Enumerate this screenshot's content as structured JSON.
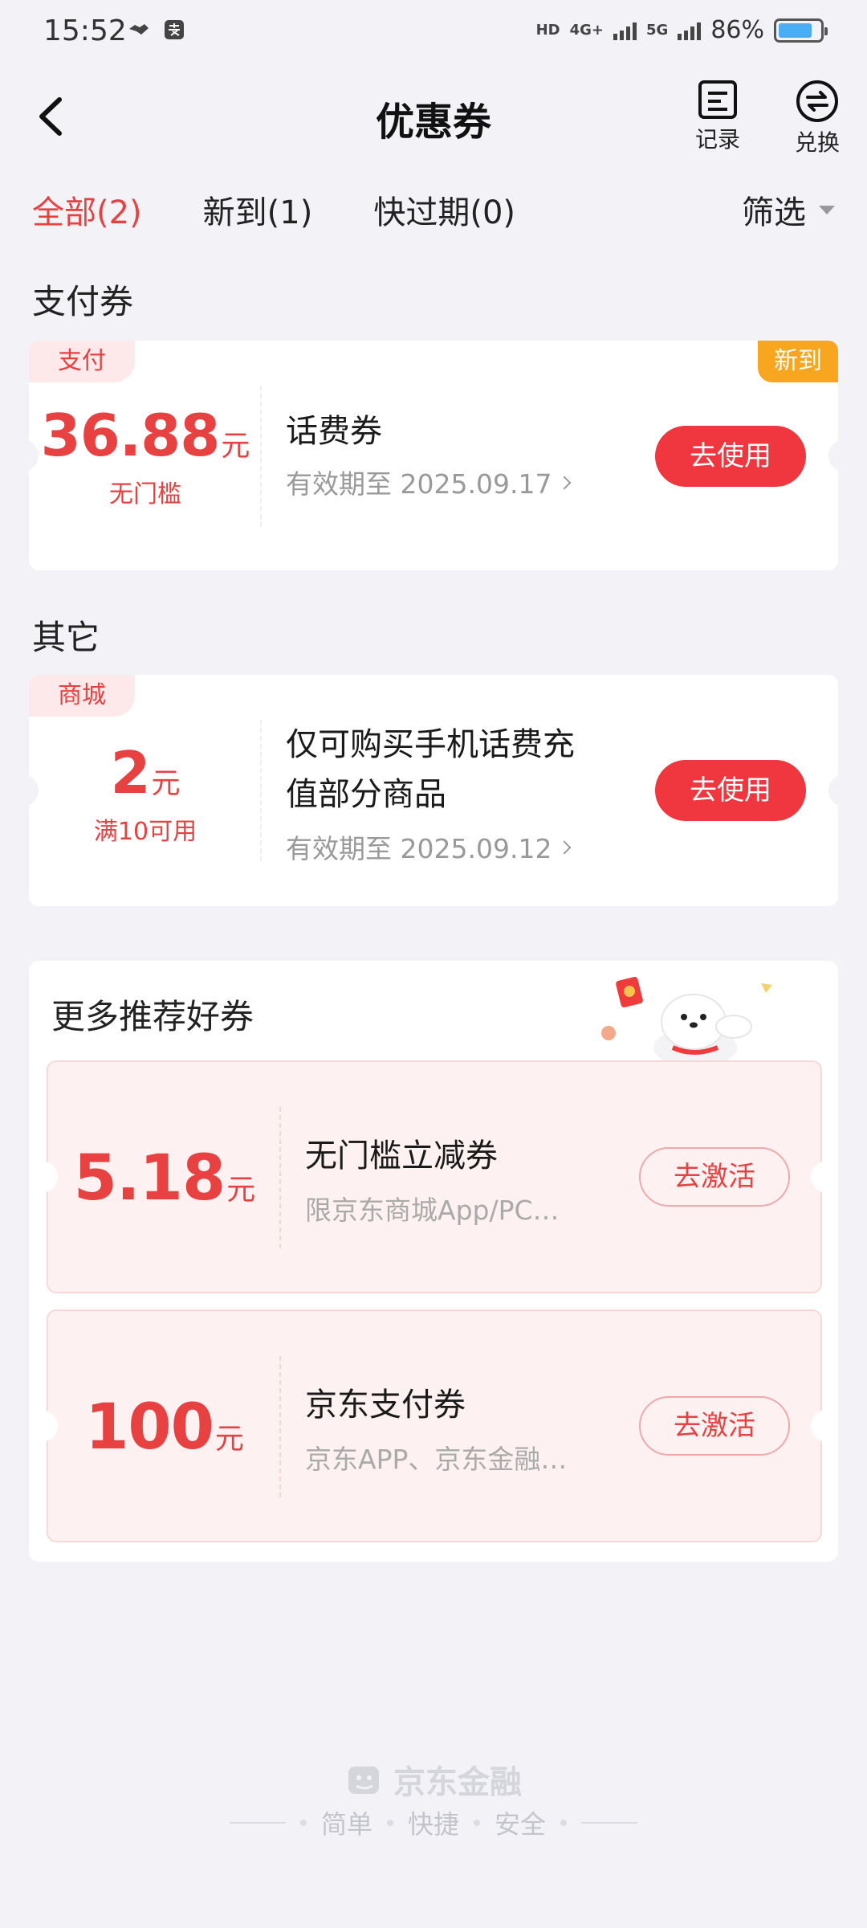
{
  "status": {
    "time": "15:52",
    "battery": "86%",
    "network1": "HD",
    "network2": "4G+",
    "network3": "5G"
  },
  "nav": {
    "title": "优惠券",
    "record_label": "记录",
    "exchange_label": "兑换"
  },
  "tabs": [
    {
      "label": "全部(2)",
      "active": true
    },
    {
      "label": "新到(1)",
      "active": false
    },
    {
      "label": "快过期(0)",
      "active": false
    }
  ],
  "filter_label": "筛选",
  "sections": {
    "pay": {
      "title": "支付券",
      "coupon": {
        "tag": "支付",
        "badge": "新到",
        "amount": "36.88",
        "unit": "元",
        "condition": "无门槛",
        "title": "话费券",
        "date": "有效期至 2025.09.17",
        "button": "去使用"
      }
    },
    "other": {
      "title": "其它",
      "coupon": {
        "tag": "商城",
        "amount": "2",
        "unit": "元",
        "condition": "满10可用",
        "title_line1": "仅可购买手机话费充",
        "title_line2": "值部分商品",
        "date": "有效期至 2025.09.12",
        "button": "去使用"
      }
    }
  },
  "recommend": {
    "title": "更多推荐好券",
    "items": [
      {
        "amount": "5.18",
        "unit": "元",
        "title": "无门槛立减券",
        "desc": "限京东商城App/PC…",
        "button": "去激活"
      },
      {
        "amount": "100",
        "unit": "元",
        "title": "京东支付券",
        "desc": "京东APP、京东金融…",
        "button": "去激活"
      }
    ]
  },
  "footer": {
    "brand": "京东金融",
    "slogan": [
      "简单",
      "快捷",
      "安全"
    ]
  },
  "colors": {
    "accent": "#e84141",
    "button": "#f0373f",
    "badge": "#f8a61f",
    "background": "#f2f2f7"
  }
}
